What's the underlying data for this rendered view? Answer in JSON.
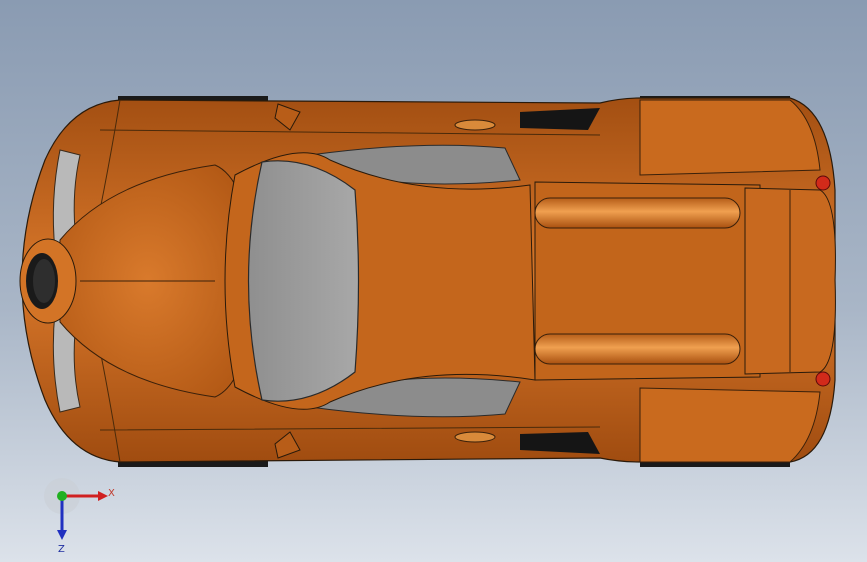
{
  "viewport": {
    "background_top": "#8a9bb2",
    "background_bottom": "#dce2ea",
    "model_color": "#c8681c",
    "glass_color": "#9a9a9a"
  },
  "triad": {
    "x_label": "X",
    "z_label": "Z",
    "x_color": "#d02020",
    "y_color": "#20b020",
    "z_color": "#2030c0"
  }
}
